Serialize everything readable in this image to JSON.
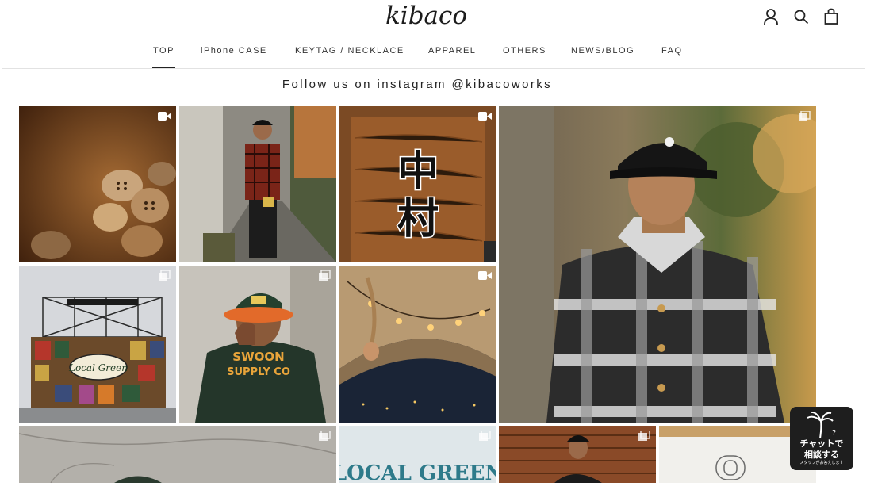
{
  "header": {
    "logo": "kibaco",
    "icons": [
      "account-icon",
      "search-icon",
      "cart-icon"
    ]
  },
  "nav": {
    "items": [
      {
        "label": "TOP",
        "active": true
      },
      {
        "label": "iPhone CASE",
        "active": false
      },
      {
        "label": "KEYTAG / NECKLACE",
        "active": false
      },
      {
        "label": "APPAREL",
        "active": false
      },
      {
        "label": "OTHERS",
        "active": false
      },
      {
        "label": "NEWS/BLOG",
        "active": false
      },
      {
        "label": "FAQ",
        "active": false
      }
    ]
  },
  "instagram": {
    "heading": "Follow us on instagram @kibacoworks",
    "posts": [
      {
        "subject": "wooden buttons",
        "type": "video"
      },
      {
        "subject": "man in red plaid shirt in alley",
        "type": "image"
      },
      {
        "subject": "wooden sign with kanji",
        "type": "video",
        "kanji": "中村"
      },
      {
        "subject": "man in black cap and plaid shirt",
        "type": "carousel"
      },
      {
        "subject": "Local Green festival stage",
        "type": "carousel",
        "sign": "Local Green"
      },
      {
        "subject": "man in green sweatshirt and orange cap",
        "type": "carousel",
        "text": "SWOON SUPPLY CO"
      },
      {
        "subject": "tent with string lights at night",
        "type": "video"
      },
      {
        "subject": "concrete ground with cap",
        "type": "carousel"
      },
      {
        "subject": "Local Green sign",
        "type": "carousel",
        "text": "LOCAL GREEN"
      },
      {
        "subject": "man at rusty wall",
        "type": "carousel"
      },
      {
        "subject": "logo sketch on paper",
        "type": "carousel"
      }
    ]
  },
  "chat": {
    "line1": "チャットで",
    "line2": "相談する",
    "line3": "スタッフがお答えします"
  },
  "colors": {
    "text": "#222222",
    "chat_bg": "#1e1e1e"
  }
}
